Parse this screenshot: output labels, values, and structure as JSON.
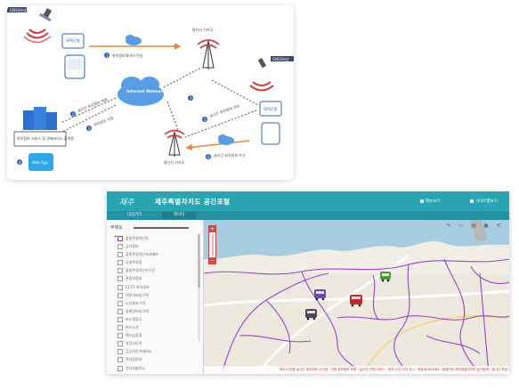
{
  "diagram": {
    "satellite_top_label": "GNSS위성",
    "satellite_right_label": "GNSS위성",
    "device_top_label": "GPS단말",
    "device_right_label": "GPS단말",
    "tower_top_label": "통신사 기지국",
    "tower_bottom_label": "통신사 기지국",
    "internet_label": "Internet Network",
    "server_label": "위치정보 서비스 및 관제서비스 플랫폼",
    "app_label": "Web App",
    "link_gps_label": "위치정보데이터 전송",
    "link_server_label": "위치정보 수집",
    "link_data_label": "실시간 위치정보 제공",
    "link_right_label": "실시간 위치정보 전송",
    "link_right_label2": "실시간 위치정보 수신",
    "step_labels": [
      "1",
      "2",
      "3",
      "4",
      "5",
      "6",
      "7"
    ],
    "colors": {
      "arrow": "#e8873a",
      "badge": "#2e5fb8",
      "cloud": "#5a9ce6",
      "tower": "#d43a3a"
    }
  },
  "portal": {
    "logo": "제주",
    "title": "제주특별자치도 공간포털",
    "header_buttons": [
      "메뉴보기",
      "사이트맵보기"
    ],
    "tabs": [
      "대상관리",
      "레이어"
    ],
    "sidebar_heading": "주제도",
    "layers": [
      "불법주정차단속",
      "공사정보",
      "불법주정차단속카메라",
      "공영주차장",
      "불법주정차단속구간",
      "관광지정보",
      "CCTV 위치정보",
      "어린이보호구역",
      "노인보호구역",
      "장애인보호구역",
      "버스정류소",
      "버스노선",
      "택시승강장",
      "자전거도로",
      "공공자전거대여소",
      "주차장정보",
      "전기차충전소"
    ],
    "status_text": "제주시 연동 실시간 위치정보 수신중 · 차량 위치정보 조회 · 실시간 관제 서비스 · 위치 수신 시각 표시 · 좌표계 WGS84 · 배경지도 제주특별자치도 공간정보 · 실시간 차량 이동 현황 · 관제 지도 서비스",
    "colors": {
      "header": "#2aa3b3",
      "boundary": "#9a44c8",
      "vehicle_red": "#c62c2c",
      "vehicle_green": "#4a9a40",
      "vehicle_purple": "#6a4aa8"
    }
  }
}
